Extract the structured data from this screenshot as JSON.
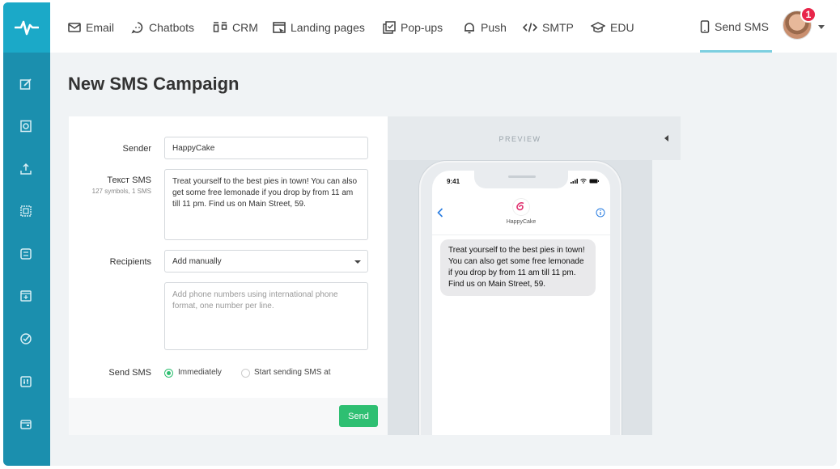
{
  "nav": {
    "items": [
      {
        "label": "Email",
        "icon": "envelope-icon"
      },
      {
        "label": "Chatbots",
        "icon": "chat-icon"
      },
      {
        "label": "CRM",
        "icon": "crm-icon"
      },
      {
        "label": "Landing pages",
        "icon": "landing-icon"
      },
      {
        "label": "Pop-ups",
        "icon": "popup-icon"
      },
      {
        "label": "Push",
        "icon": "bell-icon"
      },
      {
        "label": "SMTP",
        "icon": "code-icon"
      },
      {
        "label": "EDU",
        "icon": "graduation-cap-icon"
      }
    ],
    "active": {
      "label": "Send SMS",
      "icon": "phone-icon"
    },
    "notifications": "1"
  },
  "sidebar": {
    "icons": [
      "edit-icon",
      "mailbox-icon",
      "upload-icon",
      "template-icon",
      "automation-icon",
      "add-page-icon",
      "check-icon",
      "settings-sliders-icon",
      "wallet-icon"
    ]
  },
  "page": {
    "title": "New SMS Campaign"
  },
  "form": {
    "sender_label": "Sender",
    "sender_value": "HappyCake",
    "text_label": "Текст SMS",
    "text_counter": "127 symbols, 1 SMS",
    "text_value": "Treat yourself to the best pies in town! You can also get some free lemonade if you drop by from 11 am till 11 pm. Find us on Main Street, 59.",
    "recipients_label": "Recipients",
    "recipients_value": "Add manually",
    "phones_placeholder": "Add phone numbers using international phone format, one number per line.",
    "send_label": "Send SMS",
    "option_immediately": "Immediately",
    "option_scheduled": "Start sending SMS at",
    "send_button": "Send"
  },
  "preview": {
    "label": "PREVIEW",
    "time": "9:41",
    "contact_name": "HappyCake",
    "message": "Treat yourself to the best pies in town! You can also get some free lemonade if you drop by from 11 am till 11 pm. Find us on Main Street, 59."
  },
  "colors": {
    "sidebar": "#1b8fae",
    "accent": "#2ebf72",
    "badge": "#e8264a"
  }
}
